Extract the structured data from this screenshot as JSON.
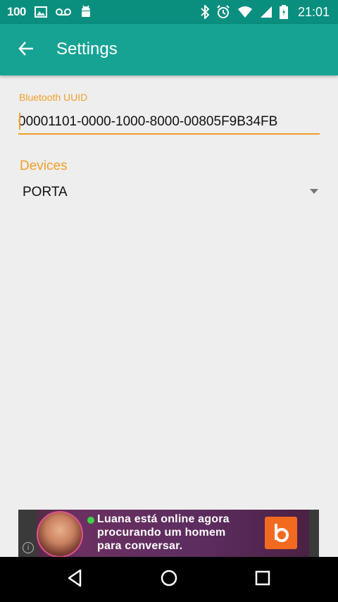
{
  "status_bar": {
    "notification_text": "100",
    "time": "21:01",
    "icons": [
      "image-icon",
      "voicemail-icon",
      "android-icon",
      "bluetooth-icon",
      "alarm-icon",
      "wifi-icon",
      "signal-icon",
      "battery-icon"
    ]
  },
  "app_bar": {
    "title": "Settings",
    "back_icon": "arrow-back-icon"
  },
  "settings": {
    "uuid_label": "Bluetooth UUID",
    "uuid_value": "00001101-0000-1000-8000-00805F9B34FB",
    "devices_title": "Devices",
    "device_selected": "PORTA"
  },
  "ad": {
    "line1": "Luana está online agora",
    "line2": "procurando um homem",
    "line3": "para conversar.",
    "info_icon": "info-icon"
  },
  "nav_bar": {
    "icons": [
      "back-triangle-icon",
      "home-circle-icon",
      "recents-square-icon"
    ]
  },
  "colors": {
    "status_bar": "#0a8f7f",
    "app_bar": "#16a394",
    "accent": "#f0a028",
    "background": "#eeeeee"
  }
}
